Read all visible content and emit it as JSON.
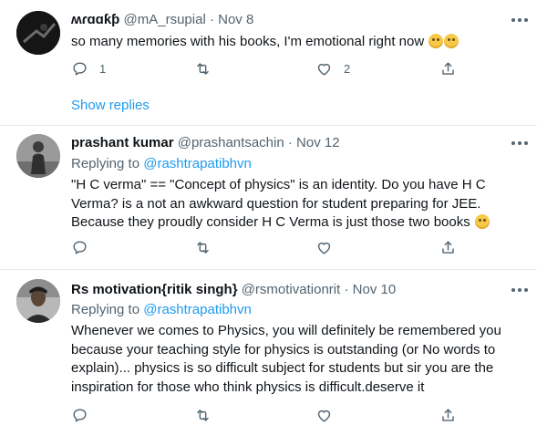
{
  "tweets": [
    {
      "name": "ʍɾɑɑƙƥ",
      "handle": "@mA_rsupial",
      "sep": "·",
      "date": "Nov 8",
      "replying_to_label": "",
      "replying_to_handle": "",
      "text": "so many memories with his books, I'm emotional right now",
      "emoji": [
        "emotional-face-emoji",
        "emotional-face-emoji"
      ],
      "reply_count": "1",
      "retweet_count": "",
      "like_count": "2",
      "show_replies": "Show replies"
    },
    {
      "name": "prashant kumar",
      "handle": "@prashantsachin",
      "sep": "·",
      "date": "Nov 12",
      "replying_to_label": "Replying to",
      "replying_to_handle": "@rashtrapatibhvn",
      "text_lines": [
        "\"H C verma\" == \"Concept of physics\" is an identity. Do you have H C",
        "Verma? is a not an awkward question for student preparing for JEE.",
        "Because they proudly consider H C Verma is just those two books"
      ],
      "emoji": [
        "smirk-emoji"
      ],
      "reply_count": "",
      "retweet_count": "",
      "like_count": ""
    },
    {
      "name": "Rs motivation{ritik singh}",
      "handle": "@rsmotivationrit",
      "sep": "·",
      "date": "Nov 10",
      "replying_to_label": "Replying to",
      "replying_to_handle": "@rashtrapatibhvn",
      "text_lines": [
        "Whenever we comes to Physics, you will definitely be remembered you",
        "because your teaching style for physics is outstanding (or No words to",
        "explain)... physics is so difficult subject for students but sir you are the",
        "inspiration for those who think physics is difficult.deserve it"
      ],
      "reply_count": "",
      "retweet_count": "",
      "like_count": ""
    }
  ],
  "icons": {
    "reply": "reply-icon",
    "retweet": "retweet-icon",
    "like": "heart-icon",
    "share": "share-icon",
    "more": "more-icon"
  },
  "colors": {
    "accent": "#1d9bf0",
    "secondary_text": "#536471",
    "divider": "#e7e9ea"
  }
}
